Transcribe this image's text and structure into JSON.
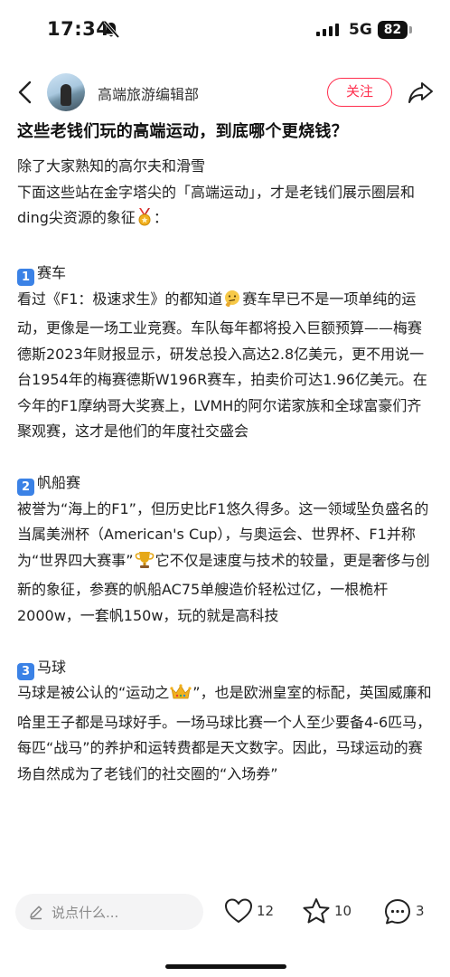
{
  "status_bar": {
    "time": "17:34",
    "network": "5G",
    "battery": "82"
  },
  "header": {
    "author": "高端旅游编辑部",
    "follow_label": "关注"
  },
  "post": {
    "title": "这些老钱们玩的高端运动，到底哪个更烧钱？",
    "intro_line1": "除了大家熟知的高尔夫和滑雪",
    "intro_line2": "下面这些站在金字塔尖的「高端运动」，才是老钱们展示圈层和ding尖资源的象征",
    "intro_tail": "：",
    "sections": [
      {
        "num": "1",
        "heading": "赛车",
        "text_a": "看过《F1：极速求生》的都知道",
        "text_b": "赛车早已不是一项单纯的运动，更像是一场工业竞赛。车队每年都将投入巨额预算——梅赛德斯2023年财报显示，研发总投入高达2.8亿美元，更不用说一台1954年的梅赛德斯W196R赛车，拍卖价可达1.96亿美元。在今年的F1摩纳哥大奖赛上，LVMH的阿尔诺家族和全球富豪们齐聚观赛，这才是他们的年度社交盛会"
      },
      {
        "num": "2",
        "heading": "帆船赛",
        "text_a": "被誉为“海上的F1”，但历史比F1悠久得多。这一领域坠负盛名的当属美洲杯（American's Cup），与奥运会、世界杯、F1并称为“世界四大赛事”",
        "text_b": "它不仅是速度与技术的较量，更是奢侈与创新的象征，参赛的帆船AC75单艘造价轻松过亿，一根桅杆2000w，一套帆150w，玩的就是高科技"
      },
      {
        "num": "3",
        "heading": "马球",
        "text_a": "马球是被公认的“运动之",
        "text_b": "”，也是欧洲皇室的标配，英国威廉和哈里王子都是马球好手。一场马球比赛一个人至少要备4-6匹马，每匹“战马”的养护和运转费都是天文数字。因此，马球运动的赛场自然成为了老钱们的社交圈的“入场券”"
      }
    ]
  },
  "bottom_bar": {
    "comment_placeholder": "说点什么...",
    "likes": "12",
    "collects": "10",
    "comments": "3"
  },
  "colors": {
    "accent": "#ff2e4d",
    "keycap": "#3b82e6"
  },
  "icons": [
    "back-arrow-icon",
    "share-icon",
    "bell-off-icon",
    "medal-icon",
    "thinking-face-icon",
    "trophy-icon",
    "crown-icon",
    "pen-icon",
    "heart-icon",
    "star-icon",
    "chat-bubble-icon"
  ]
}
